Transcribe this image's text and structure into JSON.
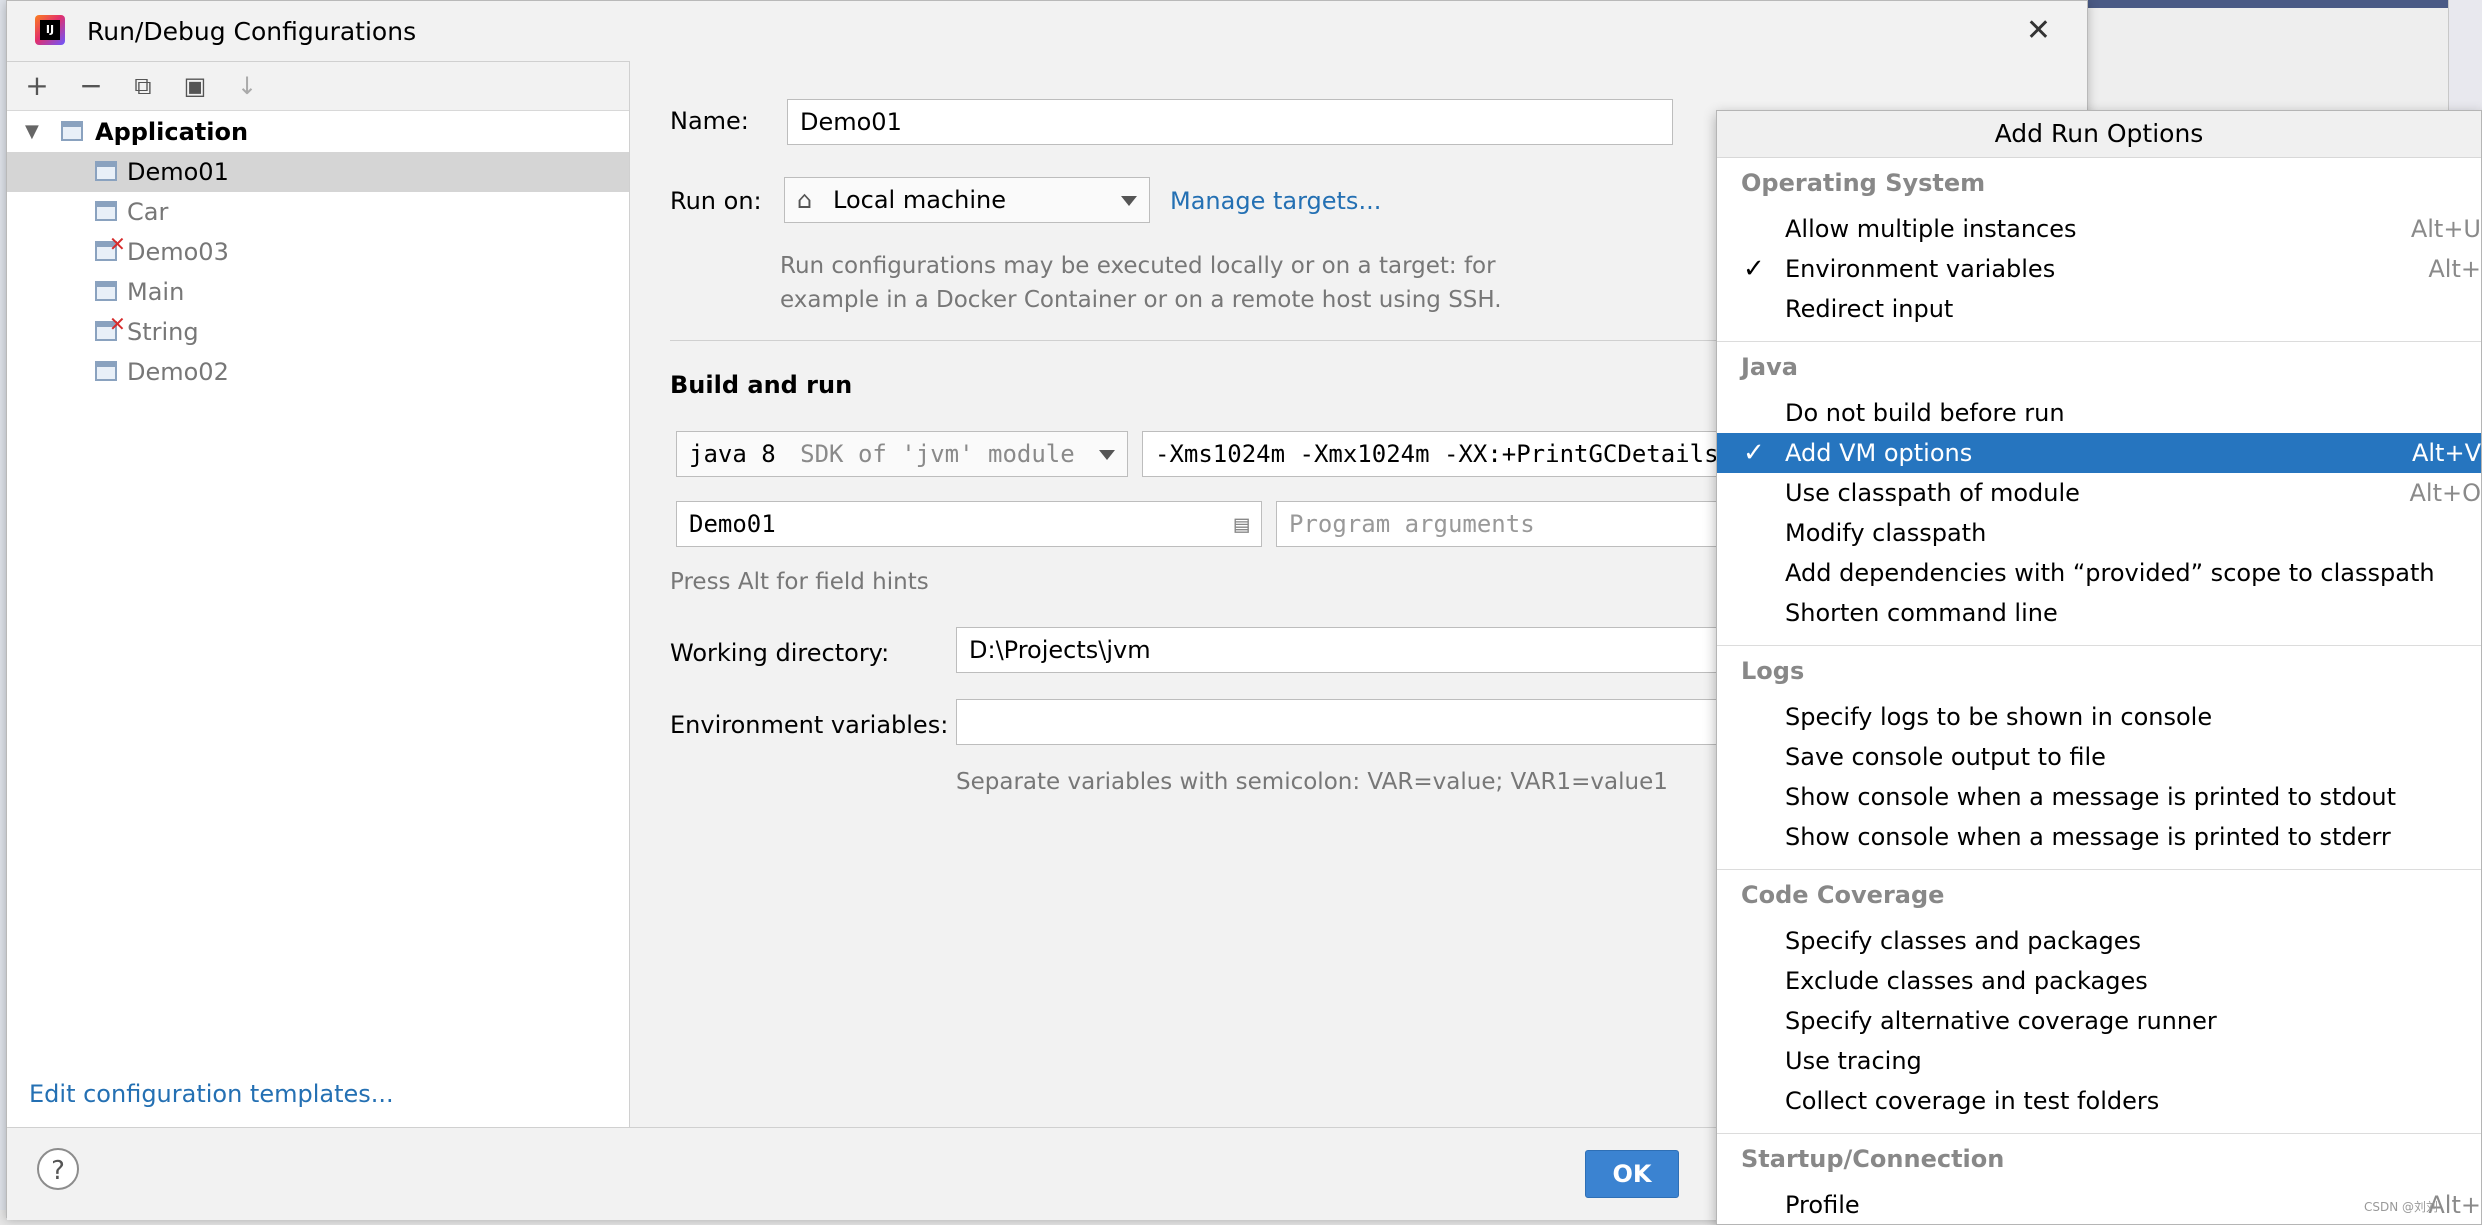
{
  "window": {
    "title": "Run/Debug Configurations"
  },
  "sidebar": {
    "root_label": "Application",
    "items": [
      {
        "label": "Demo01",
        "selected": true,
        "error": false
      },
      {
        "label": "Car",
        "selected": false,
        "error": false
      },
      {
        "label": "Demo03",
        "selected": false,
        "error": true
      },
      {
        "label": "Main",
        "selected": false,
        "error": false
      },
      {
        "label": "String",
        "selected": false,
        "error": true
      },
      {
        "label": "Demo02",
        "selected": false,
        "error": false
      }
    ],
    "templates_link": "Edit configuration templates..."
  },
  "toolbar": {
    "add": "+",
    "remove": "−",
    "copy": "⧉",
    "folder": "▣",
    "sort": "↓"
  },
  "form": {
    "name_label": "Name:",
    "name_value": "Demo01",
    "run_on_label": "Run on:",
    "run_on_value": "Local machine",
    "manage_targets": "Manage targets...",
    "run_on_hint": "Run configurations may be executed locally or on a target: for example in a Docker Container or on a remote host using SSH.",
    "build_run_title": "Build and run",
    "jdk_value": "java 8",
    "jdk_hint": "SDK of 'jvm' module",
    "vm_options": "-Xms1024m -Xmx1024m  -XX:+PrintGCDetails",
    "main_class": "Demo01",
    "program_args_placeholder": "Program arguments",
    "field_hint": "Press Alt for field hints",
    "working_dir_label": "Working directory:",
    "working_dir_value": "D:\\Projects\\jvm",
    "env_label": "Environment variables:",
    "env_value": "",
    "env_hint": "Separate variables with semicolon: VAR=value; VAR1=value1"
  },
  "footer": {
    "help": "?",
    "ok": "OK"
  },
  "popup": {
    "title": "Add Run Options",
    "os_header": "Operating System",
    "os_items": [
      {
        "label": "Allow multiple instances",
        "shortcut": "Alt+U",
        "checked": false
      },
      {
        "label": "Environment variables",
        "shortcut": "Alt+",
        "checked": true
      },
      {
        "label": "Redirect input",
        "shortcut": "",
        "checked": false
      }
    ],
    "java_header": "Java",
    "java_items": [
      {
        "label": "Do not build before run",
        "shortcut": "",
        "checked": false,
        "selected": false
      },
      {
        "label": "Add VM options",
        "shortcut": "Alt+V",
        "checked": true,
        "selected": true
      },
      {
        "label": "Use classpath of module",
        "shortcut": "Alt+O",
        "checked": false,
        "selected": false
      },
      {
        "label": "Modify classpath",
        "shortcut": "",
        "checked": false,
        "selected": false
      },
      {
        "label": "Add dependencies with “provided” scope to classpath",
        "shortcut": "",
        "checked": false,
        "selected": false
      },
      {
        "label": "Shorten command line",
        "shortcut": "",
        "checked": false,
        "selected": false
      }
    ],
    "logs_header": "Logs",
    "logs_items": [
      {
        "label": "Specify logs to be shown in console"
      },
      {
        "label": "Save console output to file"
      },
      {
        "label": "Show console when a message is printed to stdout"
      },
      {
        "label": "Show console when a message is printed to stderr"
      }
    ],
    "coverage_header": "Code Coverage",
    "coverage_items": [
      {
        "label": "Specify classes and packages"
      },
      {
        "label": "Exclude classes and packages"
      },
      {
        "label": "Specify alternative coverage runner"
      },
      {
        "label": "Use tracing"
      },
      {
        "label": "Collect coverage in test folders"
      }
    ],
    "startup_header": "Startup/Connection",
    "startup_items": [
      {
        "label": "Profile",
        "shortcut": "Alt+"
      }
    ]
  },
  "watermark": "CSDN @刘刘"
}
